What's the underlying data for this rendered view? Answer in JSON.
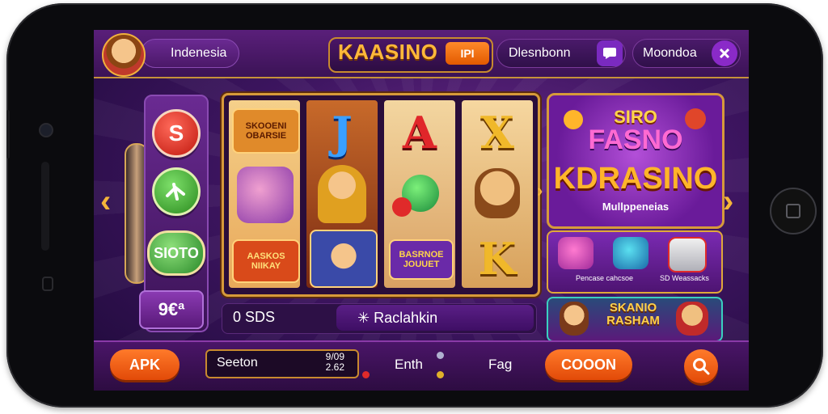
{
  "topbar": {
    "region": "Indenesia",
    "brand": "KAASINO",
    "brand_badge": "IPI",
    "user_label": "Dlesnbonn",
    "language": "Moondoa"
  },
  "left_rail": {
    "coin_red": "S",
    "coin_green": "",
    "coin_slot": "SIOTO",
    "score": "9€ª"
  },
  "reels": {
    "reel1_top": "SKOOENI OBARSIE",
    "reel1_bottom": "AASKOS NIIKAY",
    "reel2_letter": "J",
    "reel3_letter": "A",
    "reel3_bottom": "BASRNOE JOUUET",
    "reel4_letter": "X",
    "reel4_bottom": "K"
  },
  "status": {
    "left_text": "0 SDS",
    "reclaim_label": "✳ Raclahkin"
  },
  "promo": {
    "line1": "SIRO",
    "line2": "FASNO",
    "line3": "KDRASINO",
    "line4": "Mullppeneias"
  },
  "games_caption": {
    "left": "Pencase cahcsoe",
    "right": "SD Weassacks"
  },
  "bonus": {
    "text": "SKANIO RASHAM"
  },
  "bottombar": {
    "apk_label": "APK",
    "search_label": "Seeton",
    "time_top": "9/09",
    "time_bottom": "2.62",
    "middle_text": "Enth",
    "flag_text": "Fag",
    "coupon_label": "COOON"
  },
  "colors": {
    "accent_orange": "#ff7a2a",
    "gold": "#d79a3a",
    "purple_dark": "#3b1356"
  }
}
